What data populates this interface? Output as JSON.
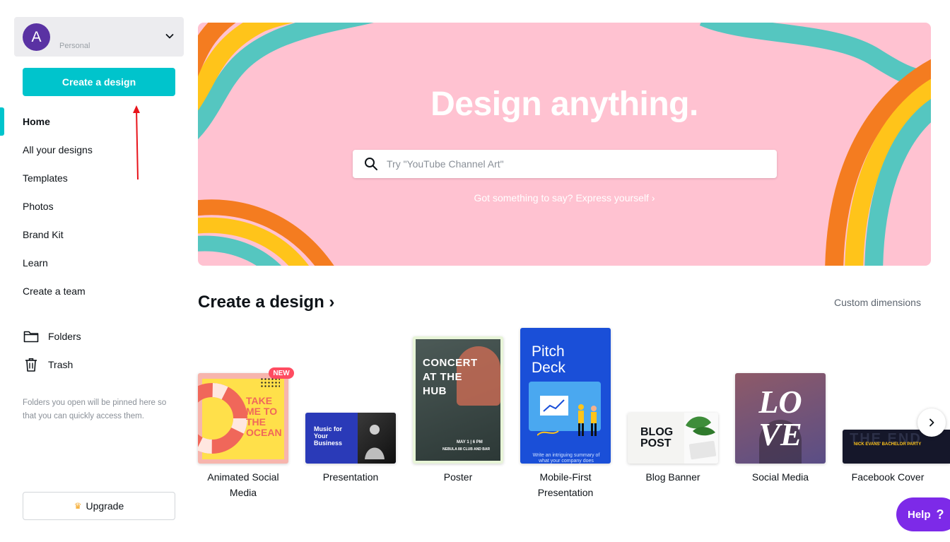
{
  "sidebar": {
    "account": {
      "avatar_letter": "A",
      "type_label": "Personal"
    },
    "create_button": "Create a design",
    "nav": [
      {
        "label": "Home",
        "active": true
      },
      {
        "label": "All your designs"
      },
      {
        "label": "Templates"
      },
      {
        "label": "Photos"
      },
      {
        "label": "Brand Kit"
      },
      {
        "label": "Learn"
      },
      {
        "label": "Create a team"
      }
    ],
    "folders": {
      "label": "Folders",
      "icon": "folder-icon"
    },
    "trash": {
      "label": "Trash",
      "icon": "trash-icon"
    },
    "hint": "Folders you open will be pinned here so that you can quickly access them.",
    "upgrade": "Upgrade"
  },
  "hero": {
    "title": "Design anything.",
    "search_placeholder": "Try \"YouTube Channel Art\"",
    "link": "Got something to say? Express yourself ›"
  },
  "create_section": {
    "title": "Create a design ›",
    "custom_dimensions": "Custom dimensions",
    "new_badge": "NEW",
    "cards": [
      {
        "label": "Animated Social Media",
        "thumb_text": [
          "TAKE",
          "ME TO",
          "THE",
          "OCEAN"
        ]
      },
      {
        "label": "Presentation",
        "thumb_text": [
          "Music for",
          "Your",
          "Business"
        ]
      },
      {
        "label": "Poster",
        "thumb_text": [
          "CONCERT",
          "AT THE",
          "HUB"
        ],
        "thumb_sub": "MAY 1 | 6 PM",
        "thumb_venue": "NEBULA 88 CLUB AND BAR"
      },
      {
        "label": "Mobile-First Presentation",
        "thumb_text": [
          "Pitch",
          "Deck"
        ],
        "thumb_sub": "Write an intriguing summary of what your company does"
      },
      {
        "label": "Blog Banner",
        "thumb_text": [
          "BLOG",
          "POST"
        ]
      },
      {
        "label": "Social Media",
        "thumb_text": [
          "LO",
          "VE"
        ]
      },
      {
        "label": "Facebook Cover",
        "thumb_text": [
          "NICK EVANS' BACHELOR PARTY"
        ]
      }
    ]
  },
  "help": {
    "label": "Help",
    "icon": "?"
  },
  "colors": {
    "accent": "#00c4cc",
    "hero_bg": "#ffc2d1",
    "wave_orange": "#f47c20",
    "wave_yellow": "#ffc41a",
    "wave_teal": "#55c6c0",
    "help_purple": "#7d2ae8",
    "avatar": "#5a32a3",
    "new_badge": "#ff4c61"
  }
}
